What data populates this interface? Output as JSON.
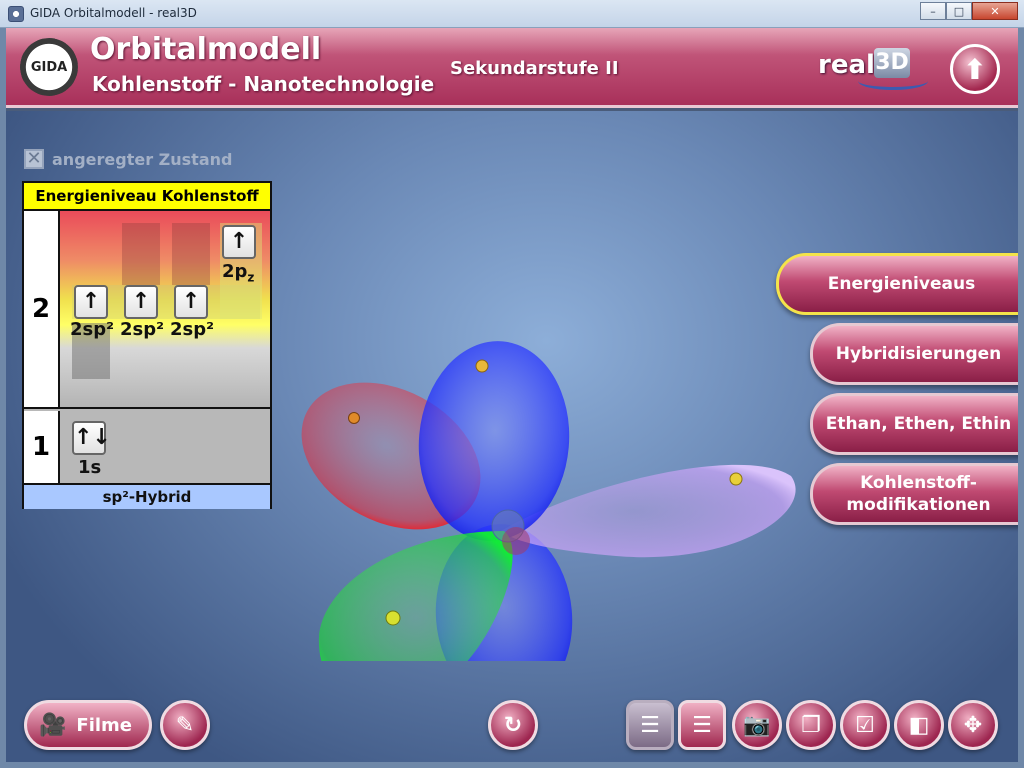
{
  "window": {
    "title": "GIDA Orbitalmodell - real3D",
    "minimize": "–",
    "maximize": "□",
    "close": "✕"
  },
  "header": {
    "logo_text": "GIDA",
    "title": "Orbitalmodell",
    "subtitle": "Kohlenstoff - Nanotechnologie",
    "level": "Sekundarstufe II",
    "brand_text": "real",
    "brand_cube": "3D",
    "up_arrow": "⬆"
  },
  "checkbox": {
    "mark": "✕",
    "label": "angeregter Zustand",
    "checked": true
  },
  "energy_table": {
    "header": "Energieniveau Kohlenstoff",
    "level2": "2",
    "level1": "1",
    "orbital_2pz": {
      "arrow": "↑",
      "label": "2p",
      "sub": "z"
    },
    "orbitals_sp2": [
      {
        "arrow": "↑",
        "label": "2sp²"
      },
      {
        "arrow": "↑",
        "label": "2sp²"
      },
      {
        "arrow": "↑",
        "label": "2sp²"
      }
    ],
    "orbital_1s": {
      "arrow": "↑↓",
      "label": "1s"
    },
    "footer": "sp²-Hybrid"
  },
  "menu": {
    "items": [
      {
        "label": "Energieniveaus",
        "active": true
      },
      {
        "label": "Hybridisierungen",
        "active": false
      },
      {
        "label": "Ethan, Ethen, Ethin",
        "active": false
      },
      {
        "label": "Kohlenstoff-modifikationen",
        "line1": "Kohlenstoff-",
        "line2": "modifikationen",
        "active": false
      }
    ]
  },
  "toolbar": {
    "filme_label": "Filme",
    "filme_icon": "🎥",
    "notes_icon": "✎",
    "reset_icon": "↻",
    "list_dim_icon": "☰",
    "list_icon": "☰",
    "camera_icon": "📷",
    "copy_icon": "❐",
    "check_icon": "☑",
    "window_icon": "◧",
    "move_icon": "✥"
  },
  "colors": {
    "header_brand": "#a8305a",
    "orbital_red": "#ff2020",
    "orbital_green": "#22e040",
    "orbital_blue": "#1f2fff",
    "orbital_violet": "#c9a2f5",
    "active_border": "#f4e34a"
  }
}
